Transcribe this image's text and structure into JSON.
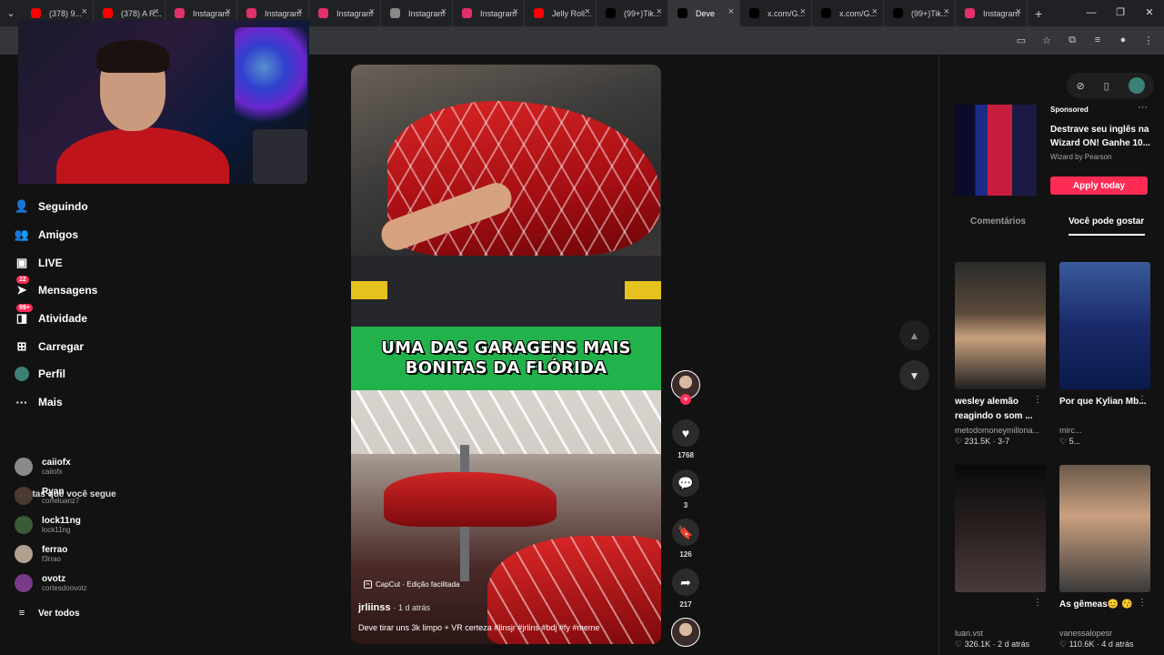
{
  "browser": {
    "tabs": [
      {
        "label": "(378) 9...",
        "icon": "youtube-icon",
        "color": "#ff0000",
        "active": false
      },
      {
        "label": "(378) A R...",
        "icon": "youtube-icon",
        "color": "#ff0000",
        "active": false
      },
      {
        "label": "Instagram",
        "icon": "instagram-icon",
        "color": "#e1306c",
        "active": false
      },
      {
        "label": "Instagram",
        "icon": "instagram-icon",
        "color": "#e1306c",
        "active": false
      },
      {
        "label": "Instagram",
        "icon": "instagram-icon",
        "color": "#e1306c",
        "active": false
      },
      {
        "label": "Instagram",
        "icon": "loading-icon",
        "color": "#888888",
        "active": false
      },
      {
        "label": "Instagram",
        "icon": "instagram-icon",
        "color": "#e1306c",
        "active": false
      },
      {
        "label": "Jelly Roll...",
        "icon": "youtube-icon",
        "color": "#ff0000",
        "active": false
      },
      {
        "label": "(99+)Tik...",
        "icon": "tiktok-icon",
        "color": "#000000",
        "active": false
      },
      {
        "label": "Deve",
        "icon": "tiktok-icon",
        "color": "#000000",
        "active": true
      },
      {
        "label": "x.com/G...",
        "icon": "x-icon",
        "color": "#000000",
        "active": false
      },
      {
        "label": "x.com/G...",
        "icon": "x-icon",
        "color": "#000000",
        "active": false
      },
      {
        "label": "(99+)Tik...",
        "icon": "tiktok-icon",
        "color": "#000000",
        "active": false
      },
      {
        "label": "Instagram",
        "icon": "instagram-icon",
        "color": "#e1306c",
        "active": false
      }
    ],
    "new_tab": "+",
    "win_controls": [
      "—",
      "❐",
      "✕"
    ]
  },
  "nav": [
    {
      "label": "Seguindo",
      "icon": "following-icon",
      "glyph": "👤",
      "badge": ""
    },
    {
      "label": "Amigos",
      "icon": "friends-icon",
      "glyph": "👥",
      "badge": ""
    },
    {
      "label": "LIVE",
      "icon": "live-icon",
      "glyph": "▣",
      "badge": ""
    },
    {
      "label": "Mensagens",
      "icon": "messages-icon",
      "glyph": "➤",
      "badge": "22"
    },
    {
      "label": "Atividade",
      "icon": "activity-icon",
      "glyph": "◨",
      "badge": "99+"
    },
    {
      "label": "Carregar",
      "icon": "upload-icon",
      "glyph": "⊞",
      "badge": ""
    },
    {
      "label": "Perfil",
      "icon": "profile-icon",
      "glyph": "",
      "badge": ""
    },
    {
      "label": "Mais",
      "icon": "more-icon",
      "glyph": "···",
      "badge": ""
    }
  ],
  "following": {
    "title": "Contas que você segue",
    "accounts": [
      {
        "name": "caiiofx",
        "handle": "caiiofx",
        "color": "#8a8a8a"
      },
      {
        "name": "Ryan",
        "handle": "corteluanz7",
        "color": "#4a3a32"
      },
      {
        "name": "lock11ng",
        "handle": "lock11ng",
        "color": "#3a5a3a"
      },
      {
        "name": "ferrao",
        "handle": "f3rrao",
        "color": "#b0a090"
      },
      {
        "name": "ovotz",
        "handle": "cortesdoovotz",
        "color": "#7a3a8a"
      }
    ],
    "see_all": "Ver todos"
  },
  "video": {
    "banner_line1": "UMA DAS GARAGENS MAIS",
    "banner_line2": "BONITAS DA FLÓRIDA",
    "capcut": "CapCut · Edição facilitada",
    "author": "jrliinss",
    "time": "· 1 d atrás",
    "description": "Deve tirar uns 3k limpo + VR certeza #linsjr #jrlins #bdj #fy #meme"
  },
  "actions": {
    "likes": "1768",
    "comments": "3",
    "saves": "126",
    "shares": "217"
  },
  "right": {
    "ad": {
      "sponsored": "Sponsored",
      "title": "Destrave seu inglês na Wizard ON! Ganhe 10...",
      "by": "Wizard by Pearson",
      "cta": "Apply today"
    },
    "tabs": {
      "comments": "Comentários",
      "you_may_like": "Você pode gostar"
    },
    "cards": [
      {
        "title": "wesley alemão reagindo o som ...",
        "author": "metodomoneymillona...",
        "stats": "♡ 231.5K · 3-7"
      },
      {
        "title": "Por que Kylian Mb...",
        "author": "mirc...",
        "stats": "♡ 5..."
      },
      {
        "title": "",
        "author": "luan.vst",
        "stats": "♡ 326.1K · 2 d atrás"
      },
      {
        "title": "As gêmeas😊 😚",
        "author": "vanessalopesr",
        "stats": "♡ 110.6K · 4 d atrás"
      }
    ]
  },
  "colors": {
    "accent": "#fe2c55",
    "banner": "#22b24c"
  }
}
